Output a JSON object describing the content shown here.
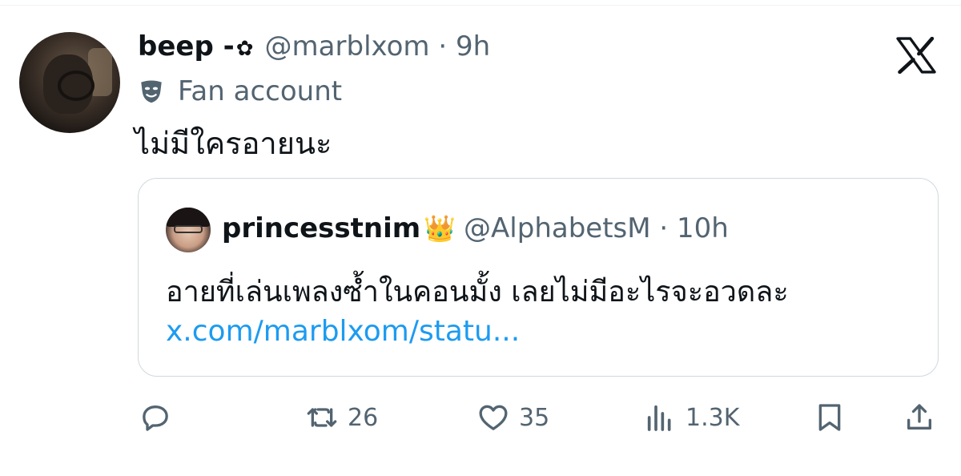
{
  "tweet": {
    "author": {
      "display_name": "beep -",
      "flower_glyph": "✿",
      "handle": "@marblxom",
      "time": "9h",
      "label": "Fan account",
      "avatar_icon": "profile-photo-headphones"
    },
    "text": "ไม่มีใครอายนะ",
    "quote": {
      "display_name": "princesstnim",
      "emoji": "👑",
      "handle": "@AlphabetsM",
      "time": "10h",
      "text": "อายที่เล่นเพลงซ้ำในคอนมั้ง เลยไม่มีอะไรจะอวดละ",
      "link": "x.com/marblxom/statu..."
    },
    "actions": {
      "reply_icon": "reply-icon",
      "retweet_count": "26",
      "like_count": "35",
      "views_count": "1.3K",
      "bookmark_icon": "bookmark-icon",
      "share_icon": "share-icon"
    }
  },
  "brand": {
    "logo": "x-logo",
    "link_color": "#1d9bf0",
    "secondary_text": "#536471"
  }
}
